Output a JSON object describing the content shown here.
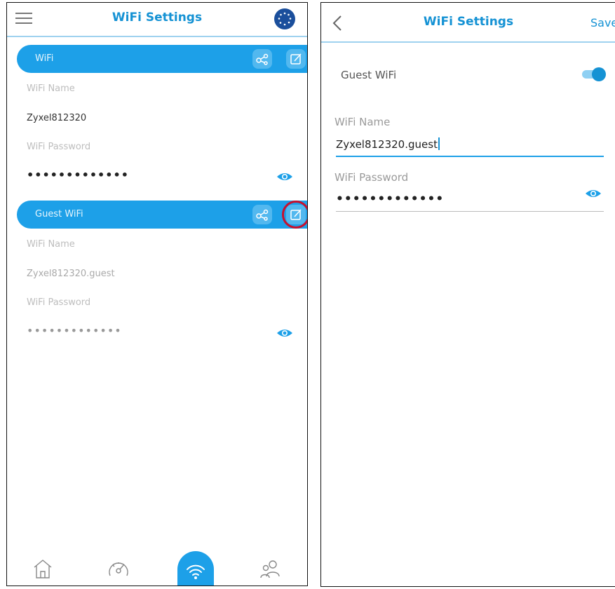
{
  "left": {
    "header": {
      "title": "WiFi Settings"
    },
    "wifi_section": {
      "title": "WiFi",
      "name_label": "WiFi Name",
      "name_value": "Zyxel812320",
      "password_label": "WiFi Password",
      "password_value": "•••••••••••••"
    },
    "guest_section": {
      "title": "Guest WiFi",
      "name_label": "WiFi Name",
      "name_value": "Zyxel812320.guest",
      "password_label": "WiFi Password",
      "password_value": "•••••••••••••"
    },
    "bottom_nav": [
      {
        "icon": "home-icon"
      },
      {
        "icon": "speedometer-icon"
      },
      {
        "icon": "wifi-icon",
        "active": true
      },
      {
        "icon": "users-icon"
      }
    ]
  },
  "right": {
    "header": {
      "title": "WiFi Settings",
      "save_label": "Save"
    },
    "guest_wifi_label": "Guest WiFi",
    "guest_wifi_enabled": true,
    "name_label": "WiFi Name",
    "name_value": "Zyxel812320.guest",
    "password_label": "WiFi Password",
    "password_value": "•••••••••••••"
  },
  "colors": {
    "accent": "#1da0e8",
    "title": "#1592d4",
    "highlight": "#c8102e",
    "globe": "#1b4f9c"
  }
}
